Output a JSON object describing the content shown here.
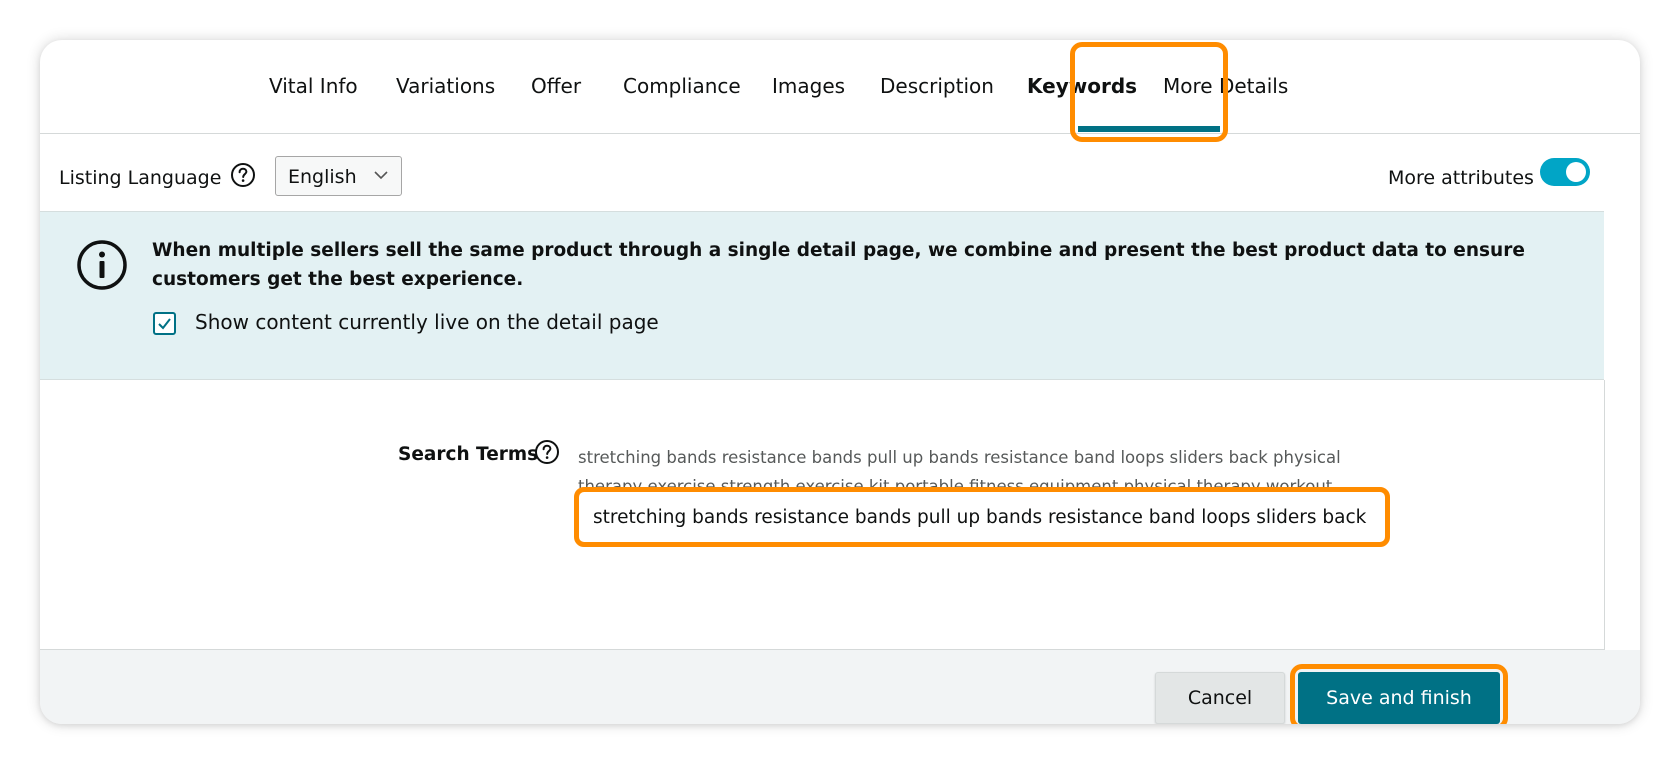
{
  "tabs": [
    {
      "label": "Vital Info",
      "active": false
    },
    {
      "label": "Variations",
      "active": false
    },
    {
      "label": "Offer",
      "active": false
    },
    {
      "label": "Compliance",
      "active": false
    },
    {
      "label": "Images",
      "active": false
    },
    {
      "label": "Description",
      "active": false
    },
    {
      "label": "Keywords",
      "active": true
    },
    {
      "label": "More Details",
      "active": false
    }
  ],
  "listing_language": {
    "label": "Listing Language",
    "help_icon": "question-circle-icon",
    "selected": "English",
    "dropdown_icon": "chevron-down-icon"
  },
  "more_attributes": {
    "label": "More attributes",
    "enabled": true
  },
  "banner": {
    "icon": "info-circle-icon",
    "message": "When multiple sellers sell the same product through a single detail page, we combine and present the best product data to ensure customers get the best experience.",
    "checkbox_label": "Show content currently live on the detail page",
    "checkbox_checked": true
  },
  "search_terms": {
    "label": "Search Terms",
    "help_icon": "question-circle-icon",
    "current_live_value": "stretching bands resistance bands pull up bands resistance band loops sliders back physical therapy exercise strength exercise kit portable fitness equipment physical therapy workout",
    "input_value": "stretching bands resistance bands pull up bands resistance band loops sliders back physical therapy exercise strength exercise kit portable fitness equipment physical therapy workout"
  },
  "footer": {
    "cancel_label": "Cancel",
    "save_label": "Save and finish"
  },
  "colors": {
    "accent": "#007185",
    "highlight": "#ff8c00",
    "toggle_on": "#01a5c6",
    "banner_bg": "#e3f1f3"
  }
}
